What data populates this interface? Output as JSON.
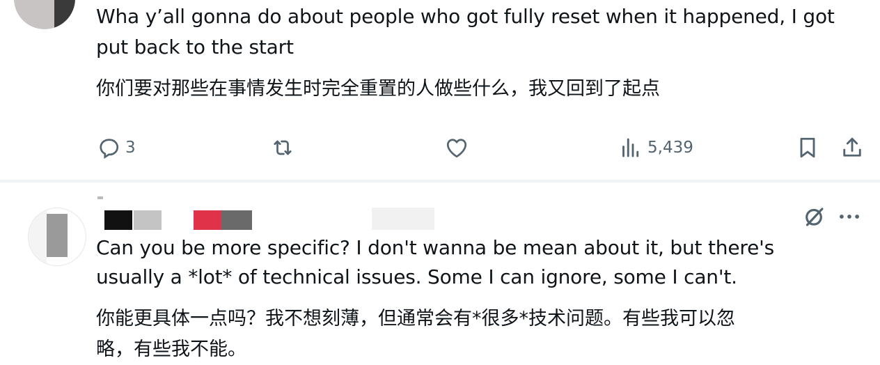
{
  "tweet1": {
    "text_en_line1": "Wha y’all gonna do about people who got fully reset when it happened, I got",
    "text_en_line2": "put back to the start",
    "text_cn": "你们要对那些在事情发生时完全重置的人做些什么，我又回到了起点",
    "actions": {
      "reply_count": "3",
      "views_count": "5,439"
    }
  },
  "tweet2": {
    "text_en_line1": "Can you be more specific? I don't wanna be mean about it, but there's",
    "text_en_line2": "usually a *lot* of technical issues. Some I can ignore, some I can't.",
    "text_cn_line1": "你能更具体一点吗？我不想刻薄，但通常会有*很多*技术问题。有些我可以忽",
    "text_cn_line2": "略，有些我不能。"
  },
  "icons": {
    "reply": "reply-icon",
    "retweet": "retweet-icon",
    "like": "heart-icon",
    "views": "views-chart-icon",
    "bookmark": "bookmark-icon",
    "share": "share-icon",
    "grok": "grok-icon",
    "more": "more-icon"
  },
  "colors": {
    "icon_gray": "#536471",
    "text": "#0f1419",
    "divider": "#eff3f4"
  }
}
